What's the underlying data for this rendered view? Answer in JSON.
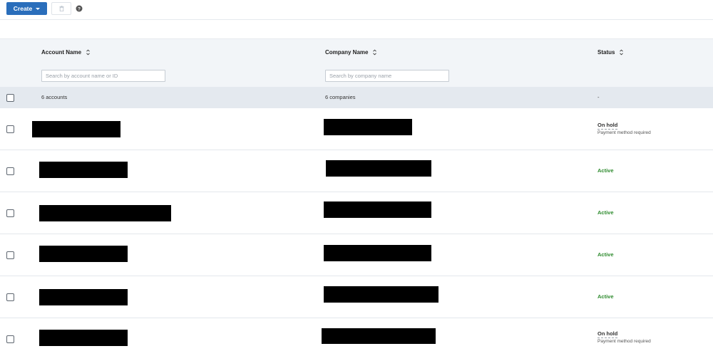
{
  "toolbar": {
    "create_label": "Create",
    "delete_icon": "trash-icon",
    "help_icon": "question-circle-icon"
  },
  "table": {
    "columns": {
      "account_name": "Account Name",
      "company_name": "Company Name",
      "status": "Status"
    },
    "filters": {
      "account_placeholder": "Search by account name or ID",
      "company_placeholder": "Search by company name"
    },
    "summary": {
      "accounts": "6 accounts",
      "companies": "6 companies",
      "status": "-"
    },
    "rows": [
      {
        "status": "On hold",
        "status_detail": "Payment method required",
        "status_type": "onhold"
      },
      {
        "status": "Active",
        "status_detail": "",
        "status_type": "active"
      },
      {
        "status": "Active",
        "status_detail": "",
        "status_type": "active"
      },
      {
        "status": "Active",
        "status_detail": "",
        "status_type": "active"
      },
      {
        "status": "Active",
        "status_detail": "",
        "status_type": "active"
      },
      {
        "status": "On hold",
        "status_detail": "Payment method required",
        "status_type": "onhold"
      }
    ]
  },
  "colors": {
    "primary": "#2a6ebb",
    "active": "#2e8b2e",
    "header_bg": "#f2f5f8",
    "summary_bg": "#e4e9ef",
    "redaction": "#000000"
  }
}
